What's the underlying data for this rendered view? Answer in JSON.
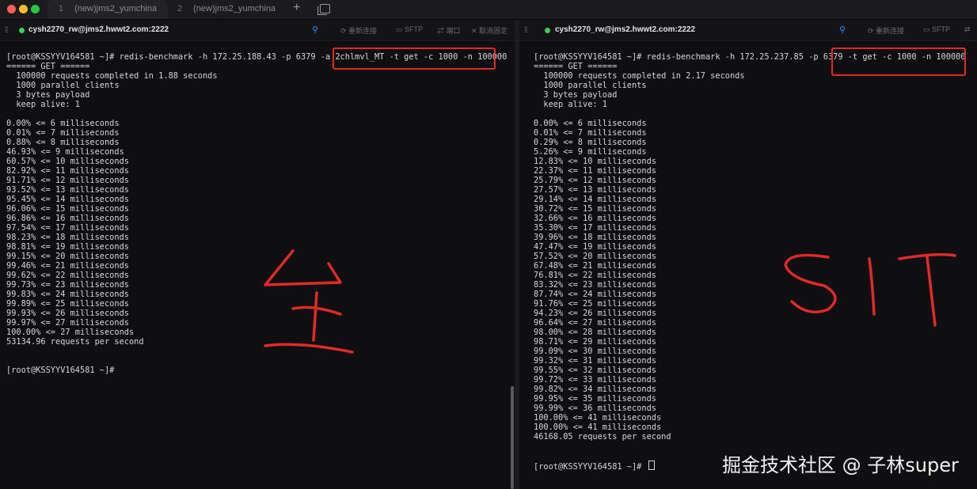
{
  "tabs": [
    {
      "num": "1",
      "label": "(new)jms2_yumchina"
    },
    {
      "num": "2",
      "label": "(new)jms2_yumchina"
    }
  ],
  "left": {
    "host": "cysh2270_rw@jms2.hwwt2.com:2222",
    "buttons": [
      "重新连接",
      "SFTP",
      "端口",
      "取消固定"
    ],
    "lines": [
      "[root@KSSYYV164581 ~]# redis-benchmark -h 172.25.188.43 -p 6379 -a 2chlmvl_MT -t get -c 1000 -n 100000",
      "====== GET ======",
      "  100000 requests completed in 1.88 seconds",
      "  1000 parallel clients",
      "  3 bytes payload",
      "  keep alive: 1",
      "",
      "0.00% <= 6 milliseconds",
      "0.01% <= 7 milliseconds",
      "0.88% <= 8 milliseconds",
      "46.93% <= 9 milliseconds",
      "60.57% <= 10 milliseconds",
      "82.92% <= 11 milliseconds",
      "91.71% <= 12 milliseconds",
      "93.52% <= 13 milliseconds",
      "95.45% <= 14 milliseconds",
      "96.06% <= 15 milliseconds",
      "96.86% <= 16 milliseconds",
      "97.54% <= 17 milliseconds",
      "98.23% <= 18 milliseconds",
      "98.81% <= 19 milliseconds",
      "99.15% <= 20 milliseconds",
      "99.46% <= 21 milliseconds",
      "99.62% <= 22 milliseconds",
      "99.73% <= 23 milliseconds",
      "99.83% <= 24 milliseconds",
      "99.89% <= 25 milliseconds",
      "99.93% <= 26 milliseconds",
      "99.97% <= 27 milliseconds",
      "100.00% <= 27 milliseconds",
      "53134.96 requests per second",
      "",
      "",
      "[root@KSSYYV164581 ~]#"
    ]
  },
  "right": {
    "host": "cysh2270_rw@jms2.hwwt2.com:2222",
    "buttons": [
      "重新连接",
      "SFTP"
    ],
    "lines": [
      "[root@KSSYYV164581 ~]# redis-benchmark -h 172.25.237.85 -p 6379 -t get -c 1000 -n 100000",
      "====== GET ======",
      "  100000 requests completed in 2.17 seconds",
      "  1000 parallel clients",
      "  3 bytes payload",
      "  keep alive: 1",
      "",
      "0.00% <= 6 milliseconds",
      "0.01% <= 7 milliseconds",
      "0.29% <= 8 milliseconds",
      "5.26% <= 9 milliseconds",
      "12.83% <= 10 milliseconds",
      "22.37% <= 11 milliseconds",
      "25.79% <= 12 milliseconds",
      "27.57% <= 13 milliseconds",
      "29.14% <= 14 milliseconds",
      "30.72% <= 15 milliseconds",
      "32.66% <= 16 milliseconds",
      "35.30% <= 17 milliseconds",
      "39.96% <= 18 milliseconds",
      "47.47% <= 19 milliseconds",
      "57.52% <= 20 milliseconds",
      "67.48% <= 21 milliseconds",
      "76.81% <= 22 milliseconds",
      "83.32% <= 23 milliseconds",
      "87.74% <= 24 milliseconds",
      "91.76% <= 25 milliseconds",
      "94.23% <= 26 milliseconds",
      "96.64% <= 27 milliseconds",
      "98.00% <= 28 milliseconds",
      "98.71% <= 29 milliseconds",
      "99.09% <= 30 milliseconds",
      "99.32% <= 31 milliseconds",
      "99.55% <= 32 milliseconds",
      "99.72% <= 33 milliseconds",
      "99.82% <= 34 milliseconds",
      "99.95% <= 35 milliseconds",
      "99.99% <= 36 milliseconds",
      "100.00% <= 41 milliseconds",
      "100.00% <= 41 milliseconds",
      "46168.05 requests per second",
      "",
      "",
      "[root@KSSYYV164581 ~]# "
    ]
  },
  "watermark": "掘金技术社区 @ 子林super",
  "colors": {
    "accent_red": "#e02a2a",
    "status_green": "#3ccf5a"
  }
}
